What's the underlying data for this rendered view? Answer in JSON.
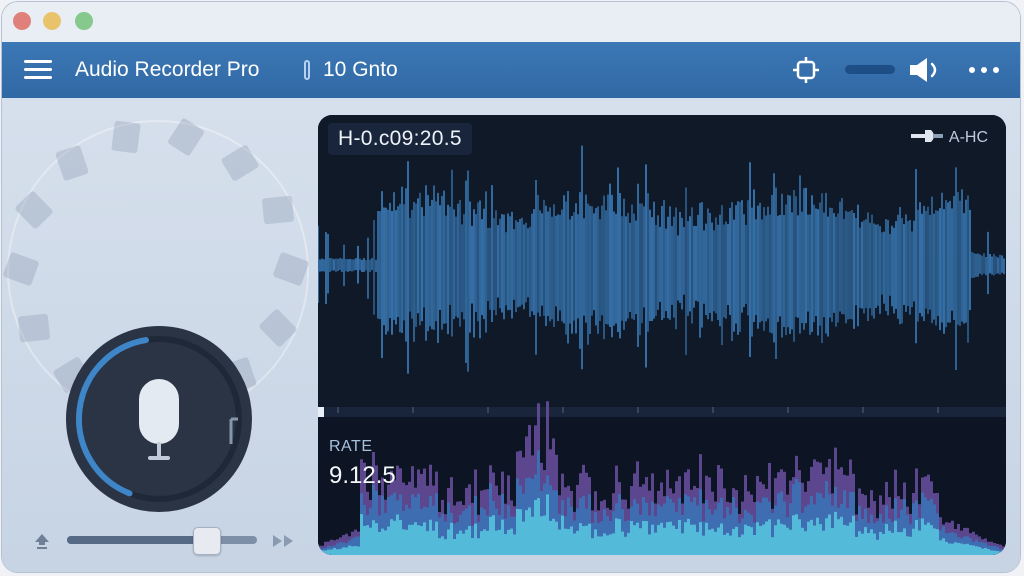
{
  "window": {
    "controls": [
      "close",
      "minimize",
      "maximize"
    ]
  },
  "toolbar": {
    "menu_icon": "hamburger-menu-icon",
    "app_title": "Audio Recorder Pro",
    "subtitle": "10 Gnto",
    "icons": [
      "crosshair-target-icon",
      "level-bar-icon",
      "speaker-volume-icon",
      "more-options-icon"
    ]
  },
  "recorder": {
    "mic_icon": "microphone-icon",
    "level": 0.45,
    "volume_icon": "upload-arrow-icon",
    "skip_icon": "fast-forward-icon"
  },
  "viewer": {
    "timestamp": "H-0.c09:20.5",
    "mode_label": "A-HC",
    "mode_icon": "audio-plug-icon",
    "rate_label": "RATE",
    "rate_value": "9.12.5",
    "playhead": 0.0
  },
  "colors": {
    "accent": "#3c78b6",
    "waveform": "#3f86c8",
    "panel_bg": "#0f1928",
    "spectrum_hi": "#58c8e0",
    "spectrum_mid": "#3a74b8",
    "spectrum_lo": "#6b4fa0"
  }
}
